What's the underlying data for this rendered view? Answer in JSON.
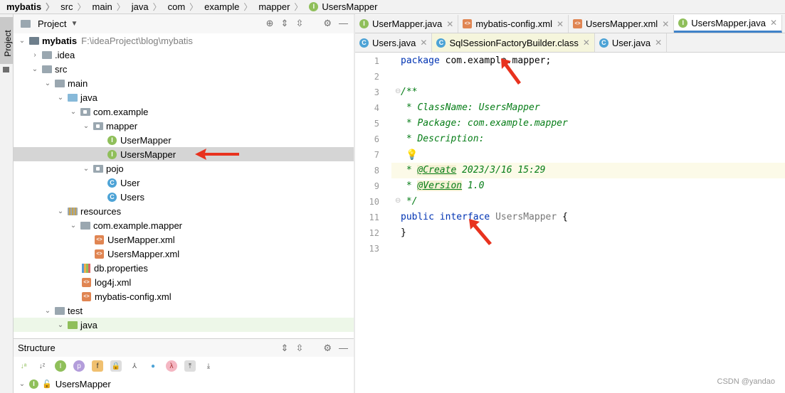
{
  "breadcrumb": [
    "mybatis",
    "src",
    "main",
    "java",
    "com",
    "example",
    "mapper",
    "UsersMapper"
  ],
  "project_panel": {
    "title": "Project"
  },
  "side_tab": "Project",
  "tree": [
    {
      "label": "mybatis",
      "extra": "F:\\ideaProject\\blog\\mybatis"
    },
    {
      "label": ".idea"
    },
    {
      "label": "src"
    },
    {
      "label": "main"
    },
    {
      "label": "java"
    },
    {
      "label": "com.example"
    },
    {
      "label": "mapper"
    },
    {
      "label": "UserMapper"
    },
    {
      "label": "UsersMapper"
    },
    {
      "label": "pojo"
    },
    {
      "label": "User"
    },
    {
      "label": "Users"
    },
    {
      "label": "resources"
    },
    {
      "label": "com.example.mapper"
    },
    {
      "label": "UserMapper.xml"
    },
    {
      "label": "UsersMapper.xml"
    },
    {
      "label": "db.properties"
    },
    {
      "label": "log4j.xml"
    },
    {
      "label": "mybatis-config.xml"
    },
    {
      "label": "test"
    },
    {
      "label": "java"
    }
  ],
  "structure": {
    "title": "Structure",
    "root": "UsersMapper"
  },
  "tabs_row1": [
    "UserMapper.java",
    "mybatis-config.xml",
    "UsersMapper.xml",
    "UsersMapper.java"
  ],
  "tabs_row2": [
    "Users.java",
    "SqlSessionFactoryBuilder.class",
    "User.java"
  ],
  "code": {
    "l1_kw": "package",
    "l1_rest": " com.example.mapper;",
    "l3": "/**",
    "l4": " * ClassName: UsersMapper",
    "l5": " * Package: com.example.mapper",
    "l6": " * Description:",
    "l8_a": " * ",
    "l8_tag": "@Create",
    "l8_b": " 2023/3/16 15:29",
    "l9_a": " * ",
    "l9_tag": "@Version",
    "l9_b": " 1.0",
    "l10": " */",
    "l11_kw1": "public",
    "l11_kw2": "interface",
    "l11_name": "UsersMapper",
    "l11_brace": " {",
    "l12": "}"
  },
  "line_numbers": [
    "1",
    "2",
    "3",
    "4",
    "5",
    "6",
    "7",
    "8",
    "9",
    "10",
    "11",
    "12",
    "13"
  ],
  "watermark": "CSDN @yandao"
}
